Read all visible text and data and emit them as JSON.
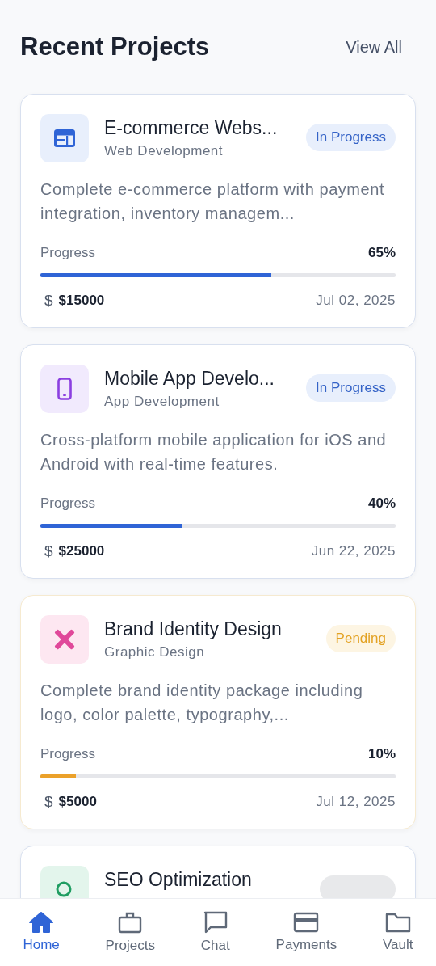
{
  "header": {
    "title": "Recent Projects",
    "link": "View All"
  },
  "projects": [
    {
      "kind": "browser",
      "title": "E-commerce Webs...",
      "category": "Web Development",
      "status": {
        "kind": "in_progress",
        "label": "In Progress"
      },
      "description": "Complete e-commerce platform with payment integration, inventory managem...",
      "progress_label": "Progress",
      "progress_text": "65%",
      "level": 0.65,
      "currency_symbol": "$",
      "amount": "$15000",
      "date": "Jul 02, 2025"
    },
    {
      "kind": "phone",
      "title": "Mobile App Develo...",
      "category": "App Development",
      "status": {
        "kind": "in_progress",
        "label": "In Progress"
      },
      "description": "Cross-platform mobile application for iOS and Android with real-time features.",
      "progress_label": "Progress",
      "progress_text": "40%",
      "level": 0.4,
      "currency_symbol": "$",
      "amount": "$25000",
      "date": "Jun 22, 2025"
    },
    {
      "kind": "design",
      "title": "Brand Identity Design",
      "category": "Graphic Design",
      "status": {
        "kind": "pending",
        "label": "Pending"
      },
      "description": "Complete brand identity package including logo, color palette, typography,...",
      "progress_label": "Progress",
      "progress_text": "10%",
      "level": 0.1,
      "currency_symbol": "$",
      "amount": "$5000",
      "date": "Jul 12, 2025"
    },
    {
      "kind": "seo",
      "title": "SEO Optimization",
      "status": {
        "kind": "other"
      }
    }
  ],
  "nav": [
    {
      "kind": "home",
      "label": "Home",
      "selected": true
    },
    {
      "kind": "briefcase",
      "label": "Projects",
      "selected": false
    },
    {
      "kind": "chat",
      "label": "Chat",
      "selected": false
    },
    {
      "kind": "card",
      "label": "Payments",
      "selected": false
    },
    {
      "kind": "folder",
      "label": "Vault",
      "selected": false
    }
  ]
}
